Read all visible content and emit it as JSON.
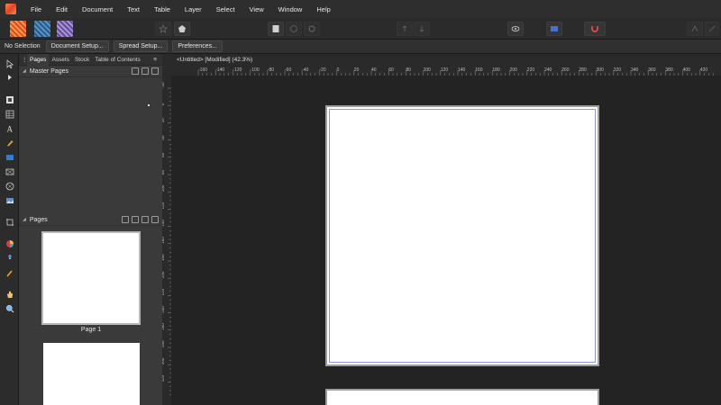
{
  "menu": {
    "items": [
      "File",
      "Edit",
      "Document",
      "Text",
      "Table",
      "Layer",
      "Select",
      "View",
      "Window",
      "Help"
    ]
  },
  "toolbar": {
    "personas": [
      "publisher-persona-icon",
      "designer-persona-icon",
      "photo-persona-icon"
    ]
  },
  "context": {
    "selection": "No Selection",
    "buttons": [
      "Document Setup...",
      "Spread Setup...",
      "Preferences..."
    ]
  },
  "panel": {
    "tabs": [
      "Pages",
      "Assets",
      "Stock",
      "Table of Contents"
    ],
    "master_title": "Master Pages",
    "pages_title": "Pages",
    "page_label": "Page 1"
  },
  "document": {
    "tab_title": "<Untitled> [Modified] (42.3%)"
  },
  "ruler": {
    "h_ticks": [
      "-160",
      "-140",
      "-120",
      "-100",
      "-80",
      "-60",
      "-40",
      "-20",
      "0",
      "20",
      "40",
      "60",
      "80",
      "100",
      "120",
      "140",
      "160",
      "180",
      "200",
      "220",
      "240",
      "260",
      "280",
      "300",
      "320",
      "340",
      "360",
      "380",
      "400",
      "420"
    ],
    "v_ticks": [
      "-20",
      "0",
      "20",
      "40",
      "60",
      "80",
      "100",
      "120",
      "140",
      "160",
      "180",
      "200",
      "220",
      "240",
      "260",
      "280",
      "300",
      "320"
    ]
  },
  "colors": {
    "accent": "#4a6fd1",
    "margin_guide": "#8f98d6",
    "canvas": "#232323"
  }
}
